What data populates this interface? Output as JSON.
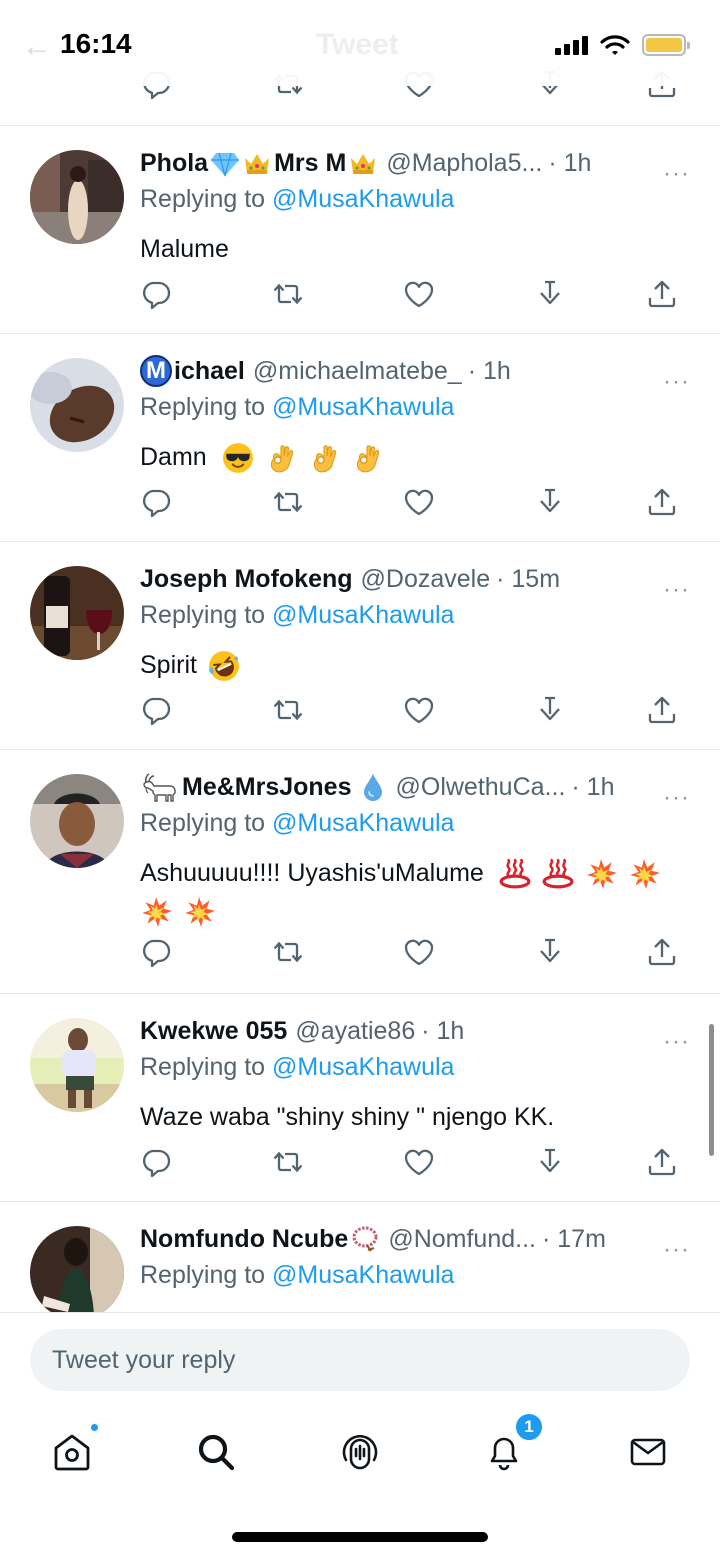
{
  "status_bar": {
    "time": "16:14",
    "faded_title": "Tweet"
  },
  "replies": [
    {
      "name": "Phola",
      "name_emoji_after": [
        "diamond",
        "crown"
      ],
      "name_part2": "Mrs M",
      "name_emoji_end": [
        "crown"
      ],
      "handle": "@Maphola5...",
      "time": "· 1h",
      "replying_prefix": "Replying to",
      "replying_to": "@MusaKhawula",
      "text": "Malume",
      "text_emoji": []
    },
    {
      "name_prefix_badge": "M",
      "name": "ichael",
      "handle": "@michaelmatebe_",
      "time": "· 1h",
      "replying_prefix": "Replying to",
      "replying_to": "@MusaKhawula",
      "text": "Damn",
      "text_emoji": [
        "sunglasses-face",
        "ok-hand",
        "ok-hand",
        "ok-hand"
      ]
    },
    {
      "name": "Joseph Mofokeng",
      "handle": "@Dozavele",
      "time": "· 15m",
      "replying_prefix": "Replying to",
      "replying_to": "@MusaKhawula",
      "text": "Spirit",
      "text_emoji": [
        "rolling-laughing-face"
      ]
    },
    {
      "name_prefix_emoji": "goat",
      "name": "Me&MrsJones",
      "name_emoji_end": [
        "droplet"
      ],
      "handle": "@OlwethuCa...",
      "time": "· 1h",
      "replying_prefix": "Replying to",
      "replying_to": "@MusaKhawula",
      "text": "Ashuuuuu!!!! Uyashis'uMalume",
      "text_emoji": [
        "hot-springs",
        "hot-springs",
        "collision",
        "collision",
        "collision",
        "collision"
      ]
    },
    {
      "name": "Kwekwe 055",
      "handle": "@ayatie86",
      "time": "· 1h",
      "replying_prefix": "Replying to",
      "replying_to": "@MusaKhawula",
      "text": "Waze waba \"shiny shiny \" njengo KK.",
      "text_emoji": []
    },
    {
      "name": "Nomfundo Ncube",
      "name_emoji_end": [
        "prayer-beads"
      ],
      "handle": "@Nomfund...",
      "time": "· 17m",
      "replying_prefix": "Replying to",
      "replying_to": "@MusaKhawula",
      "text": "",
      "text_emoji": []
    }
  ],
  "more_label": "···",
  "action_icons": [
    "reply-icon",
    "retweet-icon",
    "like-icon",
    "download-icon",
    "share-icon"
  ],
  "reply_box": {
    "placeholder": "Tweet your reply"
  },
  "tab_bar": {
    "items": [
      "home-icon",
      "search-icon",
      "spaces-icon",
      "notifications-icon",
      "messages-icon"
    ],
    "notifications_badge": "1"
  },
  "colors": {
    "accent": "#1d9bf0",
    "secondary_text": "#536471",
    "divider": "#e6e9ec"
  }
}
